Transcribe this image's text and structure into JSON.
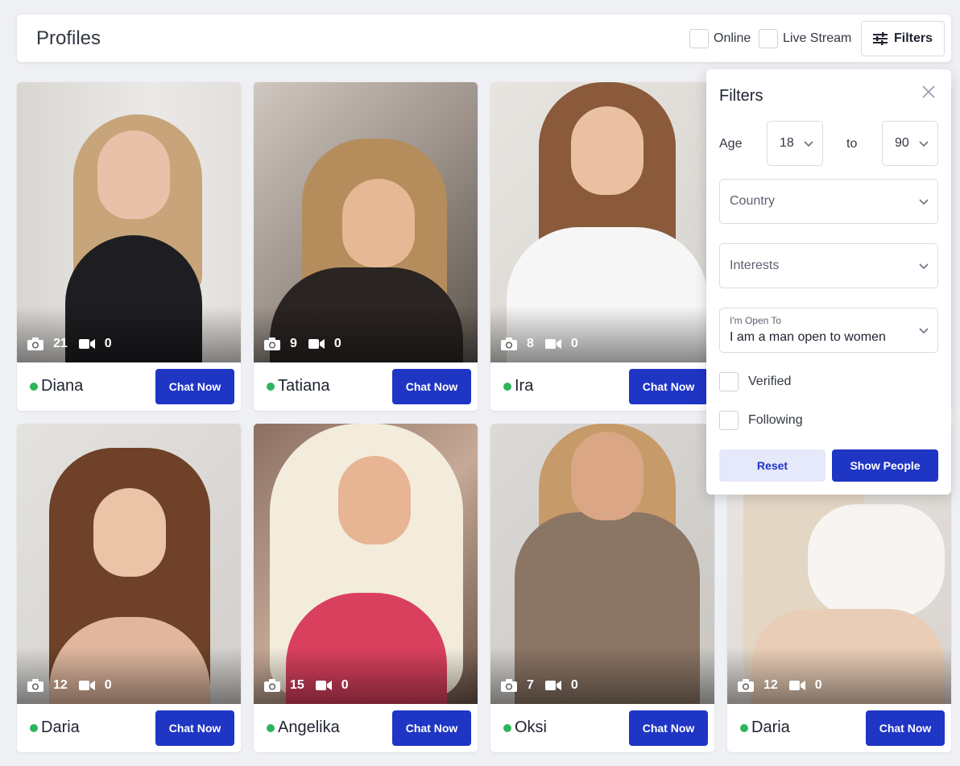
{
  "header": {
    "title": "Profiles",
    "online_label": "Online",
    "live_stream_label": "Live Stream",
    "filters_label": "Filters"
  },
  "profiles": [
    {
      "name": "Diana",
      "photos": "21",
      "videos": "0",
      "chat_label": "Chat Now"
    },
    {
      "name": "Tatiana",
      "photos": "9",
      "videos": "0",
      "chat_label": "Chat Now"
    },
    {
      "name": "Ira",
      "photos": "8",
      "videos": "0",
      "chat_label": "Chat Now"
    },
    {
      "name": "Daria",
      "photos": "12",
      "videos": "0",
      "chat_label": "Chat Now"
    },
    {
      "name": "Angelika",
      "photos": "15",
      "videos": "0",
      "chat_label": "Chat Now"
    },
    {
      "name": "Oksi",
      "photos": "7",
      "videos": "0",
      "chat_label": "Chat Now"
    },
    {
      "name": "Daria",
      "photos": "12",
      "videos": "0",
      "chat_label": "Chat Now"
    }
  ],
  "filters_panel": {
    "title": "Filters",
    "age_label": "Age",
    "age_from": "18",
    "to_label": "to",
    "age_to": "90",
    "country_placeholder": "Country",
    "interests_placeholder": "Interests",
    "open_to_label": "I'm Open To",
    "open_to_value": "I am a man open to women",
    "verified_label": "Verified",
    "following_label": "Following",
    "reset_label": "Reset",
    "show_label": "Show People"
  },
  "colors": {
    "accent": "#1f35c4",
    "online_dot": "#2db55d",
    "background": "#eff0f4"
  }
}
